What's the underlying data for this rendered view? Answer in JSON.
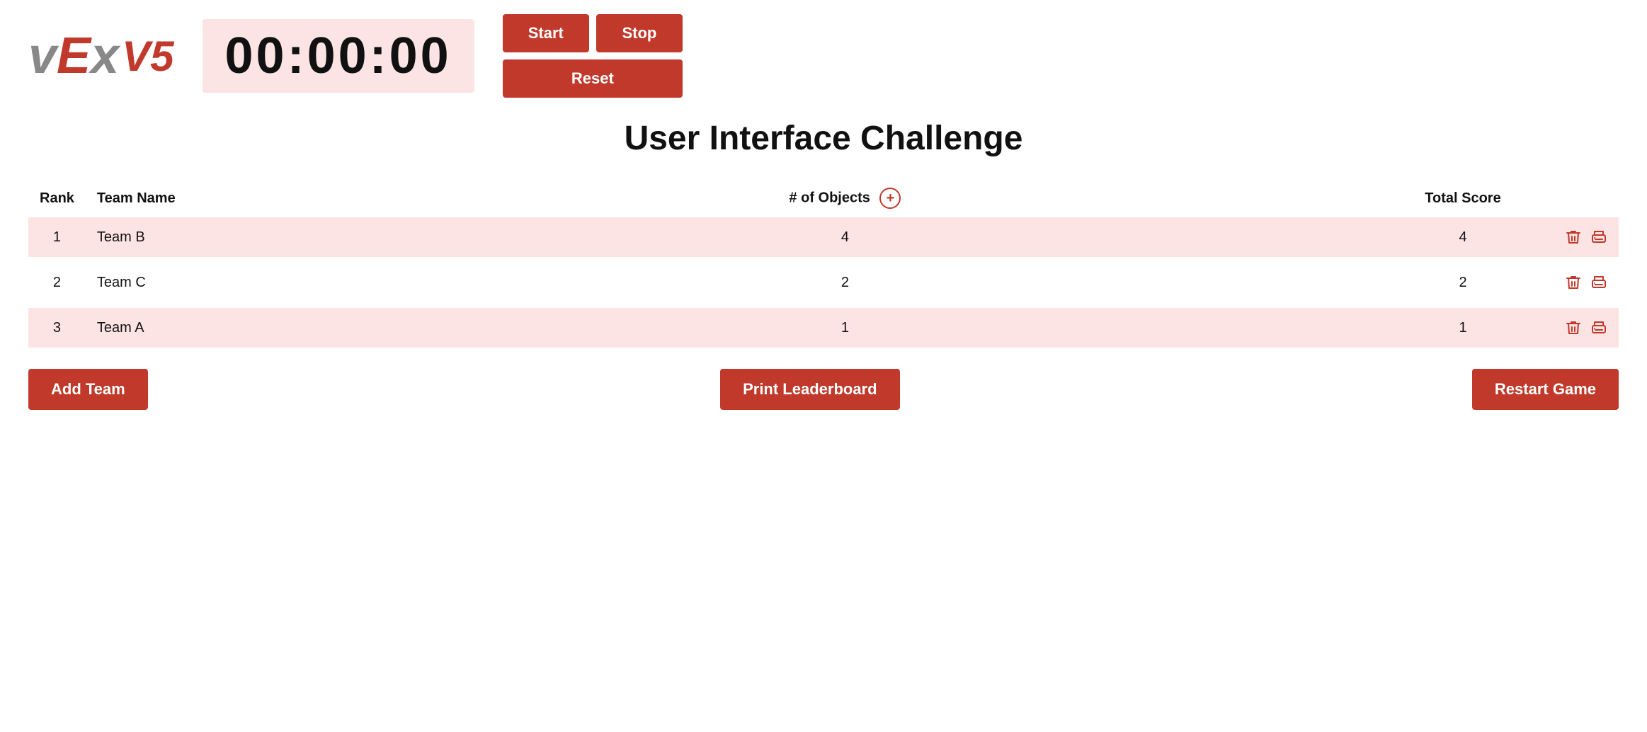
{
  "logo": {
    "v": "v",
    "e": "E",
    "x": "x",
    "v5": "V5"
  },
  "timer": {
    "display": "00:00:00"
  },
  "controls": {
    "start_label": "Start",
    "stop_label": "Stop",
    "reset_label": "Reset"
  },
  "page": {
    "title": "User Interface Challenge"
  },
  "table": {
    "headers": {
      "rank": "Rank",
      "team_name": "Team Name",
      "objects": "# of Objects",
      "total_score": "Total Score"
    },
    "rows": [
      {
        "rank": "1",
        "team": "Team B",
        "objects": "4",
        "score": "4",
        "shaded": true
      },
      {
        "rank": "2",
        "team": "Team C",
        "objects": "2",
        "score": "2",
        "shaded": false
      },
      {
        "rank": "3",
        "team": "Team A",
        "objects": "1",
        "score": "1",
        "shaded": true
      }
    ]
  },
  "buttons": {
    "add_team": "Add Team",
    "print_leaderboard": "Print Leaderboard",
    "restart_game": "Restart Game"
  },
  "colors": {
    "accent": "#c0392b",
    "timer_bg": "#fce4e4",
    "row_shaded": "#fce4e4"
  }
}
